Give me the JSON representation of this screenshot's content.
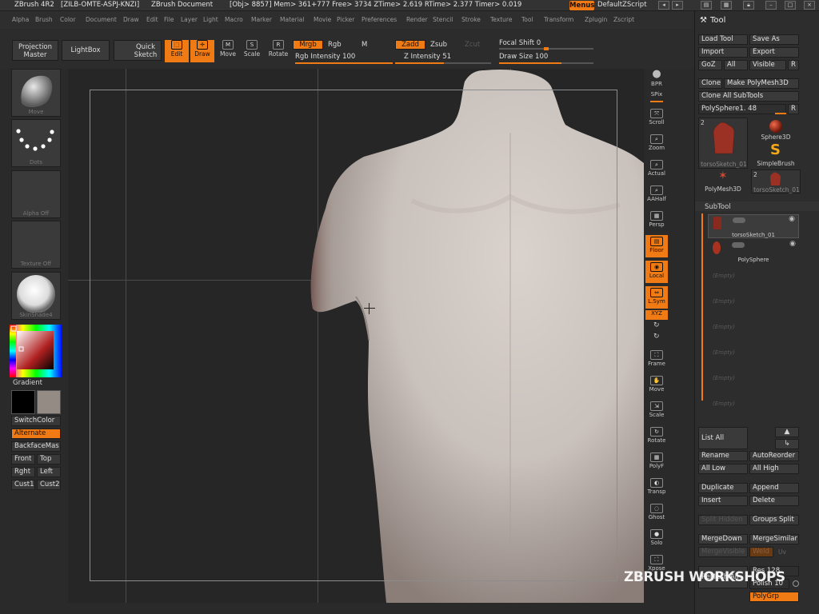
{
  "titlebar": {
    "app": "ZBrush 4R2",
    "serial": "[ZILB-OMTE-ASPJ-KNZI]",
    "document": "ZBrush Document",
    "stats": "[Obj> 8857] Mem> 361+777  Free> 3734  ZTime> 2.619  RTime> 2.377  Timer> 0.019",
    "menus_label": "Menus",
    "script_label": "DefaultZScript"
  },
  "menubar": [
    "Alpha",
    "Brush",
    "Color",
    "Document",
    "Draw",
    "Edit",
    "File",
    "Layer",
    "Light",
    "Macro",
    "Marker",
    "Material",
    "Movie",
    "Picker",
    "Preferences",
    "Render",
    "Stencil",
    "Stroke",
    "Texture",
    "Tool",
    "Transform",
    "Zplugin",
    "Zscript"
  ],
  "shelf": {
    "projection_master": "Projection Master",
    "lightbox": "LightBox",
    "quick_sketch": "Quick Sketch",
    "edit": "Edit",
    "draw": "Draw",
    "move": "Move",
    "scale": "Scale",
    "rotate": "Rotate",
    "mrgb": "Mrgb",
    "rgb": "Rgb",
    "m": "M",
    "rgb_intensity": "Rgb Intensity 100",
    "zadd": "Zadd",
    "zsub": "Zsub",
    "zcut": "Zcut",
    "z_intensity": "Z Intensity 51",
    "focal_shift": "Focal Shift 0",
    "draw_size": "Draw Size 100"
  },
  "left": {
    "brush_label": "Move",
    "stroke_label": "Dots",
    "alpha_label": "Alpha Off",
    "texture_label": "Texture Off",
    "material_label": "SkinShade4",
    "gradient": "Gradient",
    "switch_color": "SwitchColor",
    "alternate": "Alternate",
    "backface": "BackfaceMas",
    "front": "Front",
    "top": "Top",
    "right": "Rght",
    "left": "Left",
    "cust1": "Cust1",
    "cust2": "Cust2"
  },
  "righttools": [
    {
      "name": "bpr-button",
      "label": "BPR",
      "icon": "sphere"
    },
    {
      "name": "spix-slider",
      "label": "SPix",
      "icon": ""
    },
    {
      "name": "scroll-button",
      "label": "Scroll",
      "icon": "⤧"
    },
    {
      "name": "zoom-button",
      "label": "Zoom",
      "icon": "⌕"
    },
    {
      "name": "actual-button",
      "label": "Actual",
      "icon": "⌕"
    },
    {
      "name": "aahalf-button",
      "label": "AAHalf",
      "icon": "⌕"
    },
    {
      "name": "persp-button",
      "label": "Persp",
      "icon": "▦"
    },
    {
      "name": "floor-button",
      "label": "Floor",
      "icon": "▤"
    },
    {
      "name": "local-button",
      "label": "Local",
      "icon": "◉"
    },
    {
      "name": "lsym-button",
      "label": "L.Sym",
      "icon": "⇔"
    },
    {
      "name": "xyz-button",
      "label": "XYZ",
      "icon": ""
    },
    {
      "name": "frame-button",
      "label": "Frame",
      "icon": "⛶"
    },
    {
      "name": "move-view-button",
      "label": "Move",
      "icon": "✋"
    },
    {
      "name": "scale-view-button",
      "label": "Scale",
      "icon": "⇲"
    },
    {
      "name": "rotate-view-button",
      "label": "Rotate",
      "icon": "↻"
    },
    {
      "name": "polyf-button",
      "label": "PolyF",
      "icon": "▦"
    },
    {
      "name": "transp-button",
      "label": "Transp",
      "icon": "◐"
    },
    {
      "name": "ghost-button",
      "label": "Ghost",
      "icon": "◌"
    },
    {
      "name": "solo-button",
      "label": "Solo",
      "icon": "●"
    },
    {
      "name": "xpose-button",
      "label": "Xpose",
      "icon": "⛶"
    }
  ],
  "tool": {
    "title": "Tool",
    "load_tool": "Load Tool",
    "save_as": "Save As",
    "import": "Import",
    "export": "Export",
    "goz": "GoZ",
    "all": "All",
    "visible": "Visible",
    "r": "R",
    "clone": "Clone",
    "make_polymesh": "Make PolyMesh3D",
    "clone_all": "Clone All SubTools",
    "polysphere_slider": "PolySphere1. 48",
    "thumb_count_a": "2",
    "thumb_count_b": "2",
    "thumb_torso": "torsoSketch_01",
    "thumb_sphere3d": "Sphere3D",
    "thumb_simplebrush": "SimpleBrush",
    "thumb_polymesh3d": "PolyMesh3D",
    "thumb_torso2": "torsoSketch_01"
  },
  "subtool": {
    "title": "SubTool",
    "rows": [
      {
        "name": "torsoSketch_01",
        "empty": false
      },
      {
        "name": "PolySphere",
        "empty": false
      },
      {
        "name": "(Empty)",
        "empty": true
      },
      {
        "name": "(Empty)",
        "empty": true
      },
      {
        "name": "(Empty)",
        "empty": true
      },
      {
        "name": "(Empty)",
        "empty": true
      },
      {
        "name": "(Empty)",
        "empty": true
      },
      {
        "name": "(Empty)",
        "empty": true
      }
    ],
    "list_all": "List All",
    "rename": "Rename",
    "auto_reorder": "AutoReorder",
    "all_low": "All Low",
    "all_high": "All High",
    "duplicate": "Duplicate",
    "append": "Append",
    "insert": "Insert",
    "delete": "Delete",
    "split_hidden": "Split Hidden",
    "groups_split": "Groups Split",
    "merge_down": "MergeDown",
    "merge_similar": "MergeSimilar",
    "merge_visible": "MergeVisible",
    "weld": "Weld",
    "uv": "Uv",
    "remesh_all": "ReMesh All",
    "res": "Res 128",
    "polish": "Polish 10",
    "polygrp": "PolyGrp"
  },
  "watermark": "ZBRUSH WORKSHOPS",
  "colors": {
    "accent": "#f07a14",
    "panel": "#2d2d2d",
    "canvas": "#262626",
    "skin": "#cfc8c3"
  }
}
